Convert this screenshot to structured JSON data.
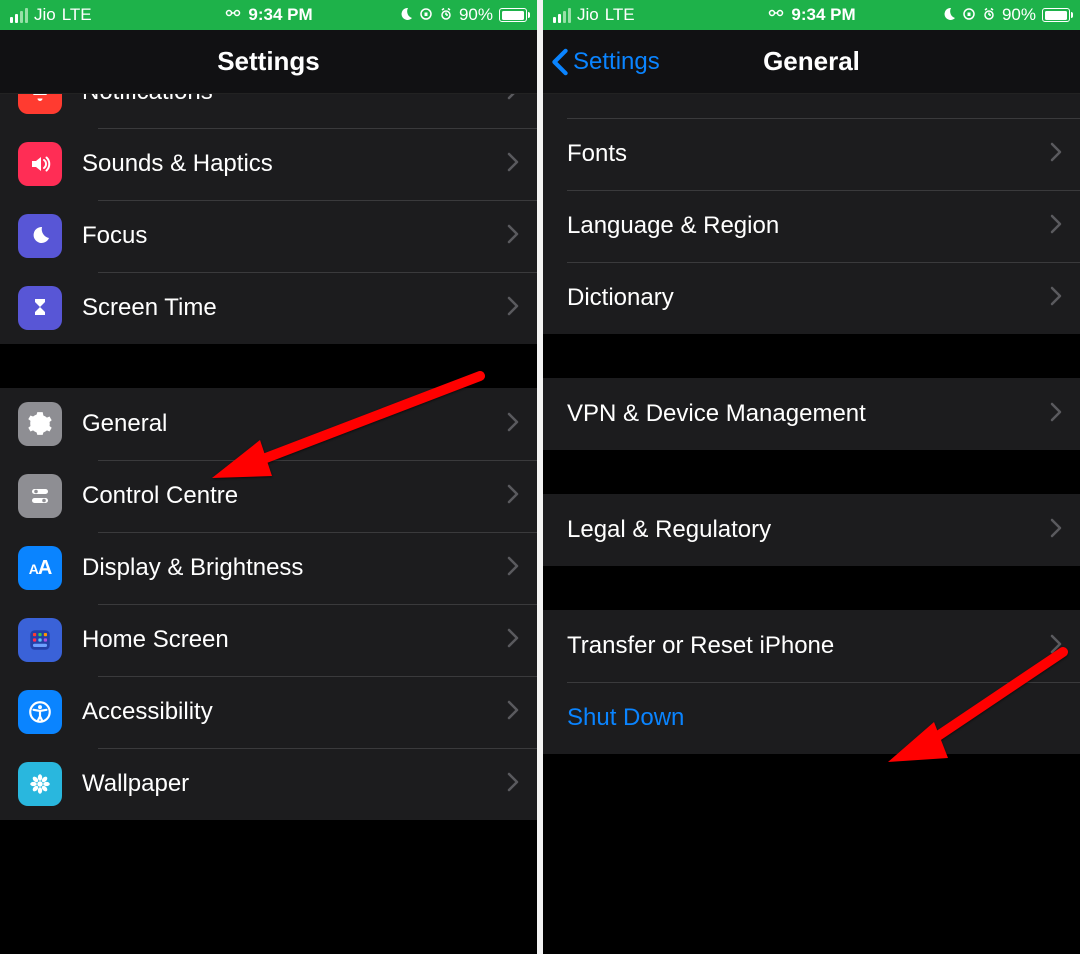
{
  "status": {
    "carrier": "Jio",
    "network": "LTE",
    "time": "9:34 PM",
    "battery_pct": "90%"
  },
  "left": {
    "title": "Settings",
    "items": [
      {
        "label": "Notifications"
      },
      {
        "label": "Sounds & Haptics"
      },
      {
        "label": "Focus"
      },
      {
        "label": "Screen Time"
      }
    ],
    "items2": [
      {
        "label": "General"
      },
      {
        "label": "Control Centre"
      },
      {
        "label": "Display & Brightness"
      },
      {
        "label": "Home Screen"
      },
      {
        "label": "Accessibility"
      },
      {
        "label": "Wallpaper"
      }
    ]
  },
  "right": {
    "back": "Settings",
    "title": "General",
    "group1": [
      {
        "label": "Fonts"
      },
      {
        "label": "Language & Region"
      },
      {
        "label": "Dictionary"
      }
    ],
    "group2": [
      {
        "label": "VPN & Device Management"
      }
    ],
    "group3": [
      {
        "label": "Legal & Regulatory"
      }
    ],
    "group4": [
      {
        "label": "Transfer or Reset iPhone"
      },
      {
        "label": "Shut Down"
      }
    ]
  }
}
